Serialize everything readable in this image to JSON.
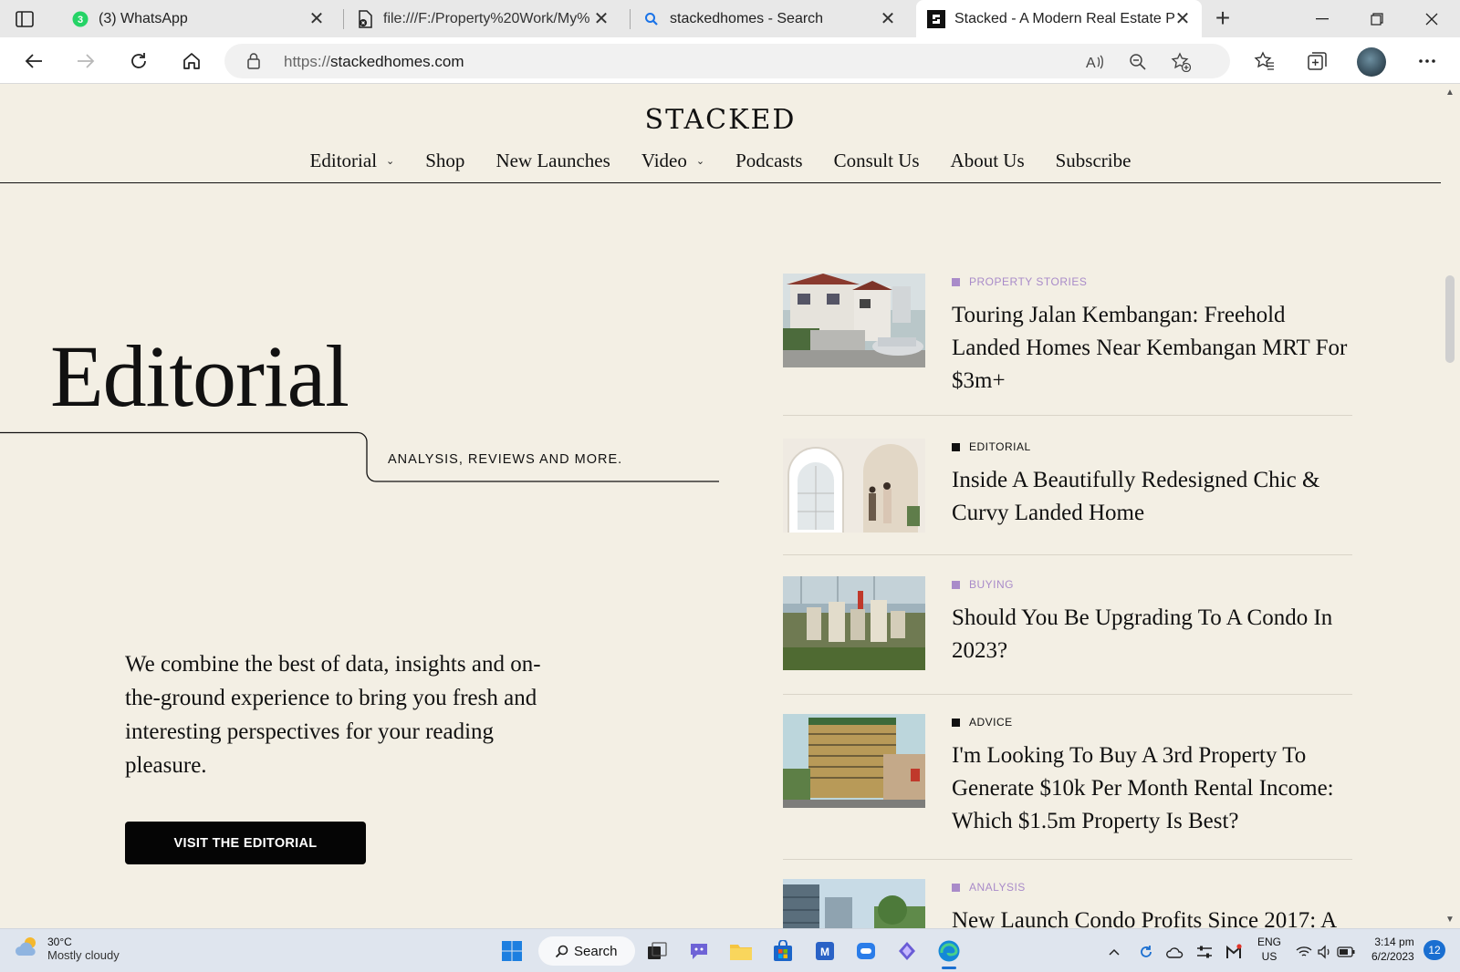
{
  "browser": {
    "tabs": [
      {
        "title": "(3) WhatsApp",
        "badge": "3",
        "favicon": "whatsapp-icon"
      },
      {
        "title": "file:///F:/Property%20Work/My%",
        "favicon": "pdf-file-icon"
      },
      {
        "title": "stackedhomes - Search",
        "favicon": "search-icon"
      },
      {
        "title": "Stacked - A Modern Real Estate P",
        "favicon": "stacked-logo-icon",
        "active": true
      }
    ],
    "new_tab": "+",
    "close_glyph": "✕",
    "address": {
      "scheme": "https://",
      "host": "stackedhomes.com"
    }
  },
  "site": {
    "brand": "STACKED",
    "nav": [
      {
        "label": "Editorial",
        "dropdown": true
      },
      {
        "label": "Shop",
        "dropdown": false
      },
      {
        "label": "New Launches",
        "dropdown": false
      },
      {
        "label": "Video",
        "dropdown": true
      },
      {
        "label": "Podcasts",
        "dropdown": false
      },
      {
        "label": "Consult Us",
        "dropdown": false
      },
      {
        "label": "About Us",
        "dropdown": false
      },
      {
        "label": "Subscribe",
        "dropdown": false
      }
    ],
    "hero": {
      "title": "Editorial",
      "tagline": "ANALYSIS, REVIEWS AND MORE.",
      "description": "We combine the best of data, insights and on-the-ground experience to bring you fresh and interesting perspectives for your reading pleasure.",
      "cta": "VISIT THE EDITORIAL"
    },
    "articles": [
      {
        "category": "PROPERTY STORIES",
        "category_color": "#a98bc9",
        "square_color": "#a98bc9",
        "headline": "Touring Jalan Kembangan: Freehold Landed Homes Near Kembangan MRT For $3m+"
      },
      {
        "category": "EDITORIAL",
        "category_color": "#111111",
        "square_color": "#111111",
        "headline": "Inside A Beautifully Redesigned Chic & Curvy Landed Home"
      },
      {
        "category": "BUYING",
        "category_color": "#a98bc9",
        "square_color": "#a98bc9",
        "headline": "Should You Be Upgrading To A Condo In 2023?"
      },
      {
        "category": "ADVICE",
        "category_color": "#111111",
        "square_color": "#111111",
        "headline": "I'm Looking To Buy A 3rd Property To Generate $10k Per Month Rental Income: Which $1.5m Property Is Best?"
      },
      {
        "category": "ANALYSIS",
        "category_color": "#a98bc9",
        "square_color": "#a98bc9",
        "headline": "New Launch Condo Profits Since 2017: A"
      }
    ]
  },
  "taskbar": {
    "weather": {
      "temp": "30°C",
      "condition": "Mostly cloudy"
    },
    "search_label": "Search",
    "language": {
      "line1": "ENG",
      "line2": "US"
    },
    "clock": {
      "time": "3:14 pm",
      "date": "6/2/2023"
    },
    "notification_count": "12"
  }
}
